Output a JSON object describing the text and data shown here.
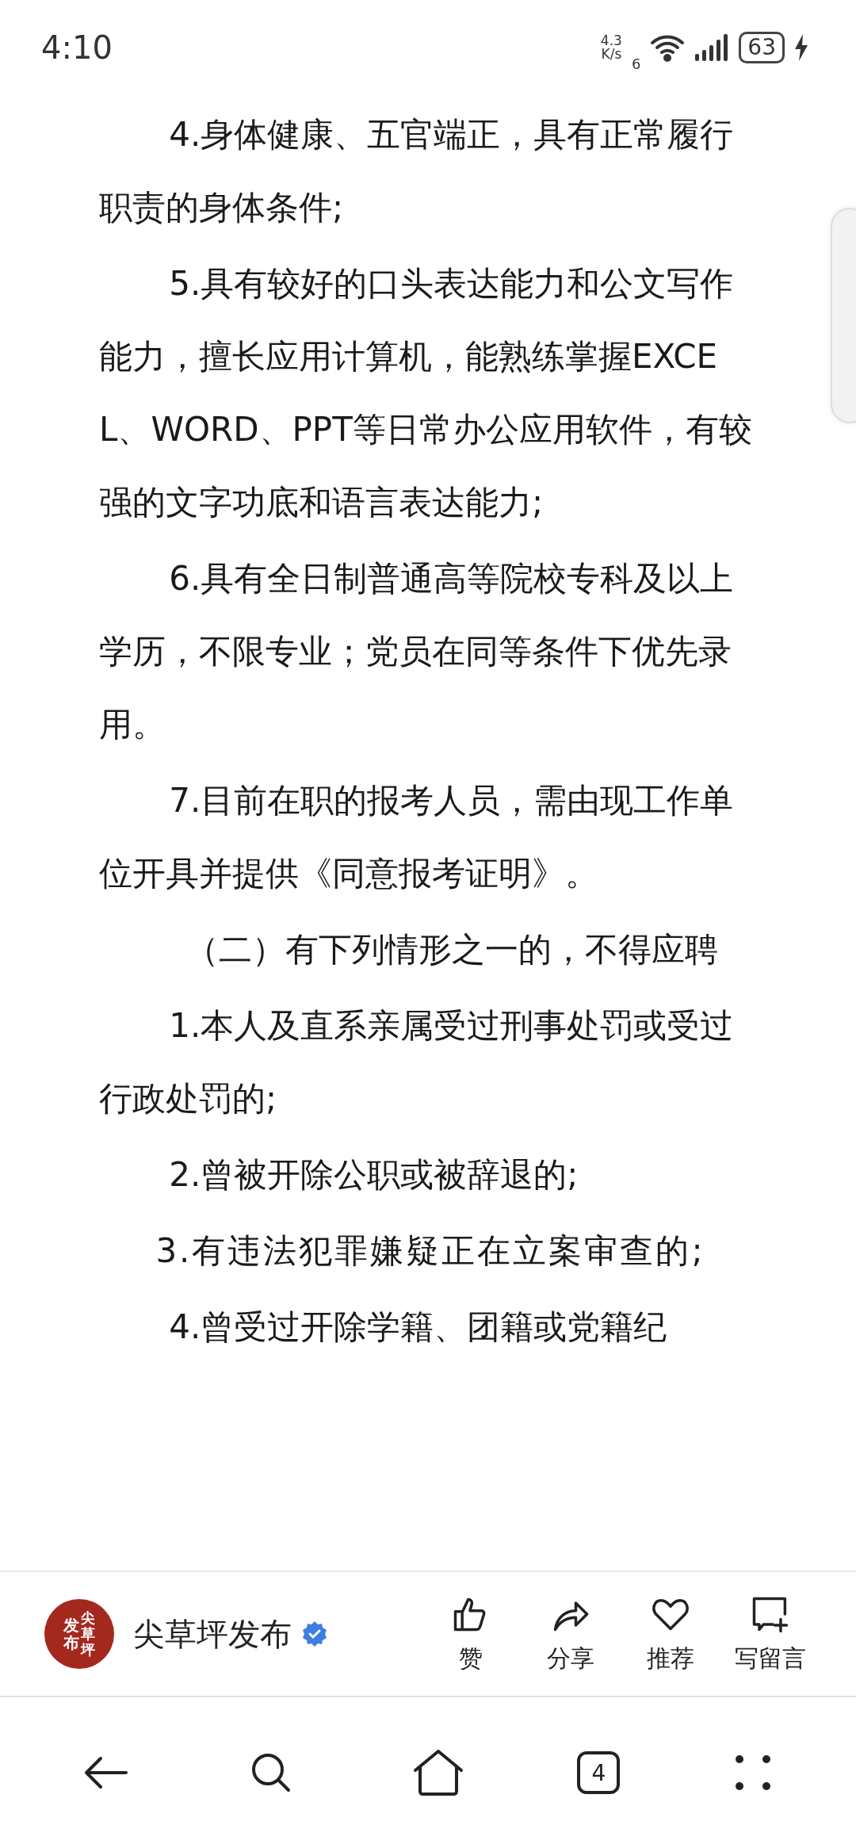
{
  "status_bar": {
    "time": "4:10",
    "net_speed_value": "4.3",
    "net_speed_unit": "K/s",
    "wifi_badge": "6",
    "battery": "63",
    "charging": true
  },
  "article": {
    "paragraphs": [
      {
        "kind": "item",
        "text": "4.身体健康、五官端正，具有正常履行职责的身体条件;"
      },
      {
        "kind": "item",
        "text": "5.具有较好的口头表达能力和公文写作能力，擅长应用计算机，能熟练掌握EXCEL、WORD、PPT等日常办公应用软件，有较强的文字功底和语言表达能力;"
      },
      {
        "kind": "item",
        "text": "6.具有全日制普通高等院校专科及以上学历，不限专业；党员在同等条件下优先录用。"
      },
      {
        "kind": "item",
        "text": "7.目前在职的报考人员，需由现工作单位开具并提供《同意报考证明》。"
      },
      {
        "kind": "heading",
        "text": "（二）有下列情形之一的，不得应聘"
      },
      {
        "kind": "item",
        "text": "1.本人及直系亲属受过刑事处罚或受过行政处罚的;"
      },
      {
        "kind": "item",
        "text": "2.曾被开除公职或被辞退的;"
      },
      {
        "kind": "spaced",
        "text": "3.有违法犯罪嫌疑正在立案审查的;"
      },
      {
        "kind": "item",
        "text": "4.曾受过开除学籍、团籍或党籍纪"
      }
    ]
  },
  "author_bar": {
    "logo_left": "发布",
    "logo_right": "尖草坪",
    "name": "尖草坪发布",
    "verified": true,
    "actions": [
      {
        "kind": "like",
        "label": "赞"
      },
      {
        "kind": "share",
        "label": "分享"
      },
      {
        "kind": "recommend",
        "label": "推荐"
      },
      {
        "kind": "comment",
        "label": "写留言"
      }
    ]
  },
  "nav_bar": {
    "tab_count": "4"
  }
}
